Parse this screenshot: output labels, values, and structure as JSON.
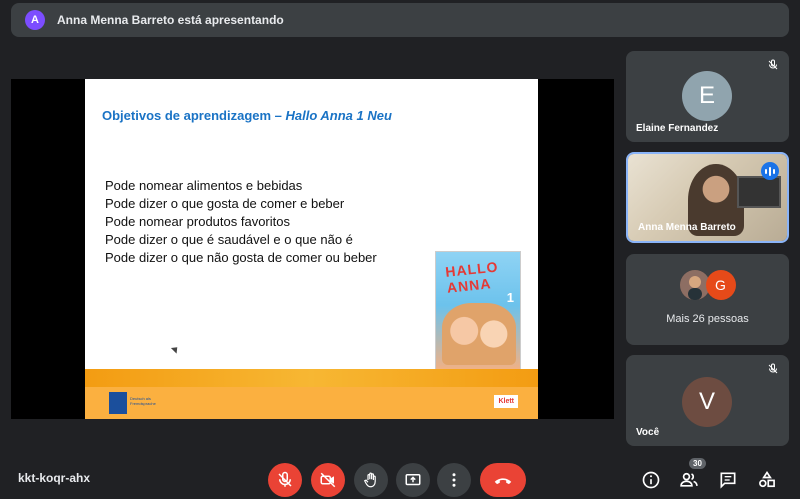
{
  "presenting_bar": {
    "avatar_letter": "A",
    "text": "Anna Menna Barreto está apresentando"
  },
  "slide": {
    "title_plain": "Objetivos de aprendizagem – ",
    "title_italic": "Hallo Anna 1 Neu",
    "bullets": [
      "Pode nomear alimentos e bebidas",
      "Pode dizer o que gosta de comer e beber",
      "Pode nomear produtos favoritos",
      "Pode dizer o que é saudável e o que não é",
      "Pode dizer o que não gosta de comer ou beber"
    ],
    "book_title": "HALLO ANNA",
    "book_number": "1",
    "footer_logo_text": "Deutsch als Fremdsprache",
    "publisher": "Klett"
  },
  "participants": [
    {
      "name": "Elaine Fernandez",
      "avatar_letter": "E",
      "avatar_color": "#90a4ae",
      "muted": true
    },
    {
      "name": "Anna Menna Barreto",
      "speaking": true
    },
    {
      "label": "Mais 26 pessoas",
      "second_avatar_letter": "G",
      "second_avatar_color": "#e64a19"
    },
    {
      "name": "Você",
      "avatar_letter": "V",
      "avatar_color": "#6d4c41",
      "muted": true
    }
  ],
  "bottom_bar": {
    "meeting_code": "kkt-koqr-ahx",
    "people_count": "30"
  },
  "icons": {
    "mic": "mic-off-icon",
    "camera": "camera-off-icon",
    "hand": "raise-hand-icon",
    "present": "present-screen-icon",
    "more": "more-vert-icon",
    "hangup": "call-end-icon",
    "info": "info-icon",
    "people": "people-icon",
    "chat": "chat-icon",
    "activities": "activities-icon"
  }
}
